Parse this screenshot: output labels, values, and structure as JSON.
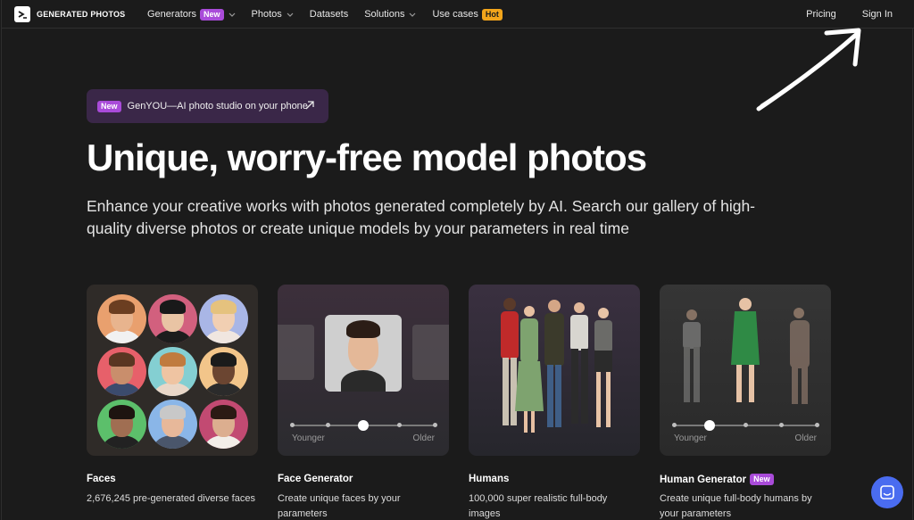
{
  "nav": {
    "logo_text": "GENERATED PHOTOS",
    "items": [
      {
        "label": "Generators",
        "badge": "New",
        "dropdown": true
      },
      {
        "label": "Photos",
        "badge": "",
        "dropdown": true
      },
      {
        "label": "Datasets",
        "badge": "",
        "dropdown": false
      },
      {
        "label": "Solutions",
        "badge": "",
        "dropdown": true
      },
      {
        "label": "Use cases",
        "badge": "Hot",
        "dropdown": false
      }
    ],
    "pricing": "Pricing",
    "sign_in": "Sign In"
  },
  "hero": {
    "pill_badge": "New",
    "pill_text": "GenYOU—AI photo studio on your phone",
    "headline": "Unique, worry-free model photos",
    "subtext": "Enhance your creative works with photos generated completely by AI. Search our gallery of high-quality diverse photos or create unique models by your parameters in real time"
  },
  "cards": [
    {
      "title": "Faces",
      "badge": "",
      "desc": "2,676,245 pre-generated diverse faces"
    },
    {
      "title": "Face Generator",
      "badge": "",
      "desc": "Create unique faces by your parameters",
      "slider_left": "Younger",
      "slider_right": "Older",
      "slider_value": 0.5
    },
    {
      "title": "Humans",
      "badge": "",
      "desc": "100,000 super realistic full-body images"
    },
    {
      "title": "Human Generator",
      "badge": "New",
      "desc": "Create unique full-body humans by your parameters",
      "slider_left": "Younger",
      "slider_right": "Older",
      "slider_value": 0.25
    }
  ],
  "colors": {
    "accent_new": "#a94bd9",
    "accent_hot": "#f3a51b",
    "chat_button": "#4a6cf0"
  }
}
